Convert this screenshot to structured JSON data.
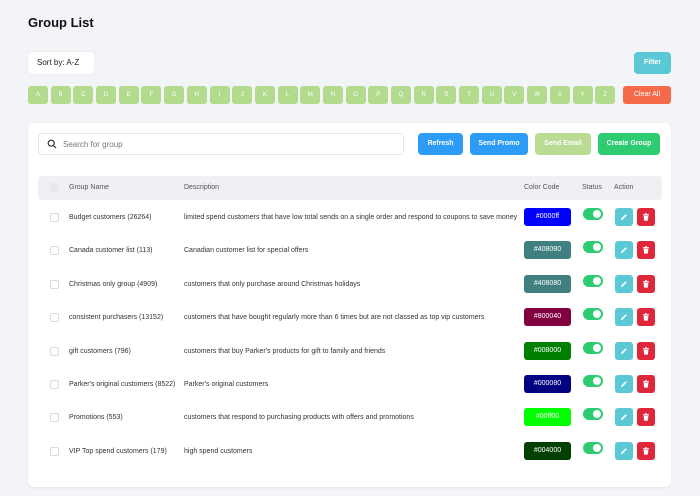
{
  "page": {
    "title": "Group List"
  },
  "toolbar": {
    "sort_label": "Sort by: A-Z",
    "filter_label": "Filter",
    "clear_label": "Clear All"
  },
  "alphabet": [
    "A",
    "B",
    "C",
    "D",
    "E",
    "F",
    "G",
    "H",
    "I",
    "J",
    "K",
    "L",
    "M",
    "N",
    "O",
    "P",
    "Q",
    "R",
    "S",
    "T",
    "U",
    "V",
    "W",
    "X",
    "Y",
    "Z"
  ],
  "search": {
    "placeholder": "Search for group",
    "value": ""
  },
  "actions": {
    "refresh": "Refresh",
    "send_promo": "Send Promo",
    "send_email": "Send Email",
    "create_group": "Create Group"
  },
  "table": {
    "headers": {
      "name": "Group Name",
      "description": "Description",
      "color": "Color Code",
      "status": "Status",
      "action": "Action"
    },
    "rows": [
      {
        "name": "Budget customers (26264)",
        "description": "limited spend customers that have low total sends on a single order and respond to coupons to save money",
        "color": "#0000ff",
        "text_color": "#ffffff",
        "status": true
      },
      {
        "name": "Canada customer list (113)",
        "description": "Canadian customer list for special offers",
        "color": "#408080",
        "text_color": "#ffffff",
        "status": true
      },
      {
        "name": "Christmas only group (4909)",
        "description": "customers that only purchase around Christmas holidays",
        "color": "#408080",
        "text_color": "#ffffff",
        "status": true
      },
      {
        "name": "consistent purchasers (13152)",
        "description": "customers that have bought regularly more than 6 times but are not classed as top vip customers",
        "color": "#800040",
        "text_color": "#ffffff",
        "status": true
      },
      {
        "name": "gift customers (796)",
        "description": "customers that buy Parker's products for gift to family and friends",
        "color": "#008000",
        "text_color": "#ffffff",
        "status": true
      },
      {
        "name": "Parker's original customers (8522)",
        "description": "Parker's original customers",
        "color": "#000080",
        "text_color": "#ffffff",
        "status": true
      },
      {
        "name": "Promotions (553)",
        "description": "customers that respond to purchasing products with offers and promotions",
        "color": "#00ff00",
        "text_color": "#ffffff",
        "status": true
      },
      {
        "name": "VIP Top spend customers (179)",
        "description": "high spend customers",
        "color": "#004000",
        "text_color": "#ffffff",
        "status": true
      }
    ]
  },
  "colors": {
    "accent_blue": "#2d9cf6",
    "accent_green": "#2ecc71",
    "alpha_green": "#b3db8e",
    "teal": "#5bc8d5",
    "danger": "#e0263a",
    "orange": "#f56b49"
  }
}
